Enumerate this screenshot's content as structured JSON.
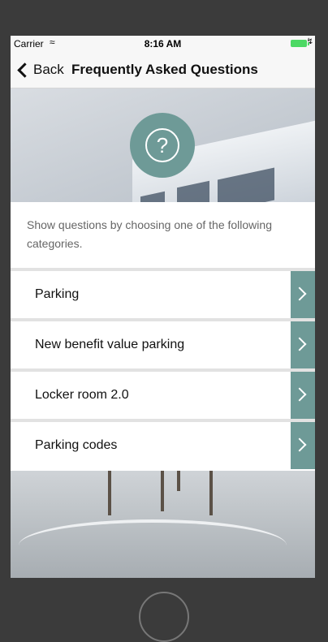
{
  "status_bar": {
    "carrier": "Carrier",
    "time": "8:16 AM"
  },
  "nav": {
    "back_label": "Back",
    "title": "Frequently Asked Questions"
  },
  "hero": {
    "icon": "question-circle-icon",
    "symbol": "?"
  },
  "intro_text": "Show questions by choosing one of the following categories.",
  "categories": [
    {
      "label": "Parking"
    },
    {
      "label": "New benefit value parking"
    },
    {
      "label": "Locker room 2.0"
    },
    {
      "label": "Parking codes"
    }
  ],
  "colors": {
    "accent": "#6e9a97",
    "frame": "#3b3b3b",
    "divider": "#e2e2e2"
  }
}
